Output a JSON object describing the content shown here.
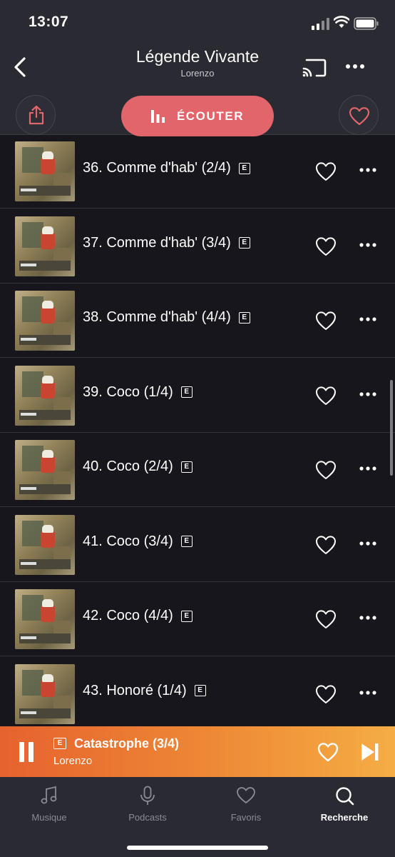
{
  "status": {
    "time": "13:07"
  },
  "header": {
    "title": "Légende Vivante",
    "subtitle": "Lorenzo",
    "listen_label": "ÉCOUTER"
  },
  "explicit_badge": "E",
  "tracks": [
    {
      "title": "36. Comme d'hab' (2/4)"
    },
    {
      "title": "37. Comme d'hab' (3/4)"
    },
    {
      "title": "38. Comme d'hab' (4/4)"
    },
    {
      "title": "39. Coco (1/4)"
    },
    {
      "title": "40. Coco (2/4)"
    },
    {
      "title": "41. Coco (3/4)"
    },
    {
      "title": "42. Coco (4/4)"
    },
    {
      "title": "43. Honoré (1/4)"
    }
  ],
  "player": {
    "title": "Catastrophe (3/4)",
    "artist": "Lorenzo",
    "state": "playing"
  },
  "tabs": [
    {
      "label": "Musique",
      "icon": "music-note-icon",
      "active": false
    },
    {
      "label": "Podcasts",
      "icon": "microphone-icon",
      "active": false
    },
    {
      "label": "Favoris",
      "icon": "heart-icon",
      "active": false
    },
    {
      "label": "Recherche",
      "icon": "search-icon",
      "active": true
    }
  ],
  "colors": {
    "accent": "#e2656c",
    "player_start": "#e6622e",
    "player_end": "#f5ad45",
    "background": "#17161c",
    "bar": "#2a2a33"
  }
}
